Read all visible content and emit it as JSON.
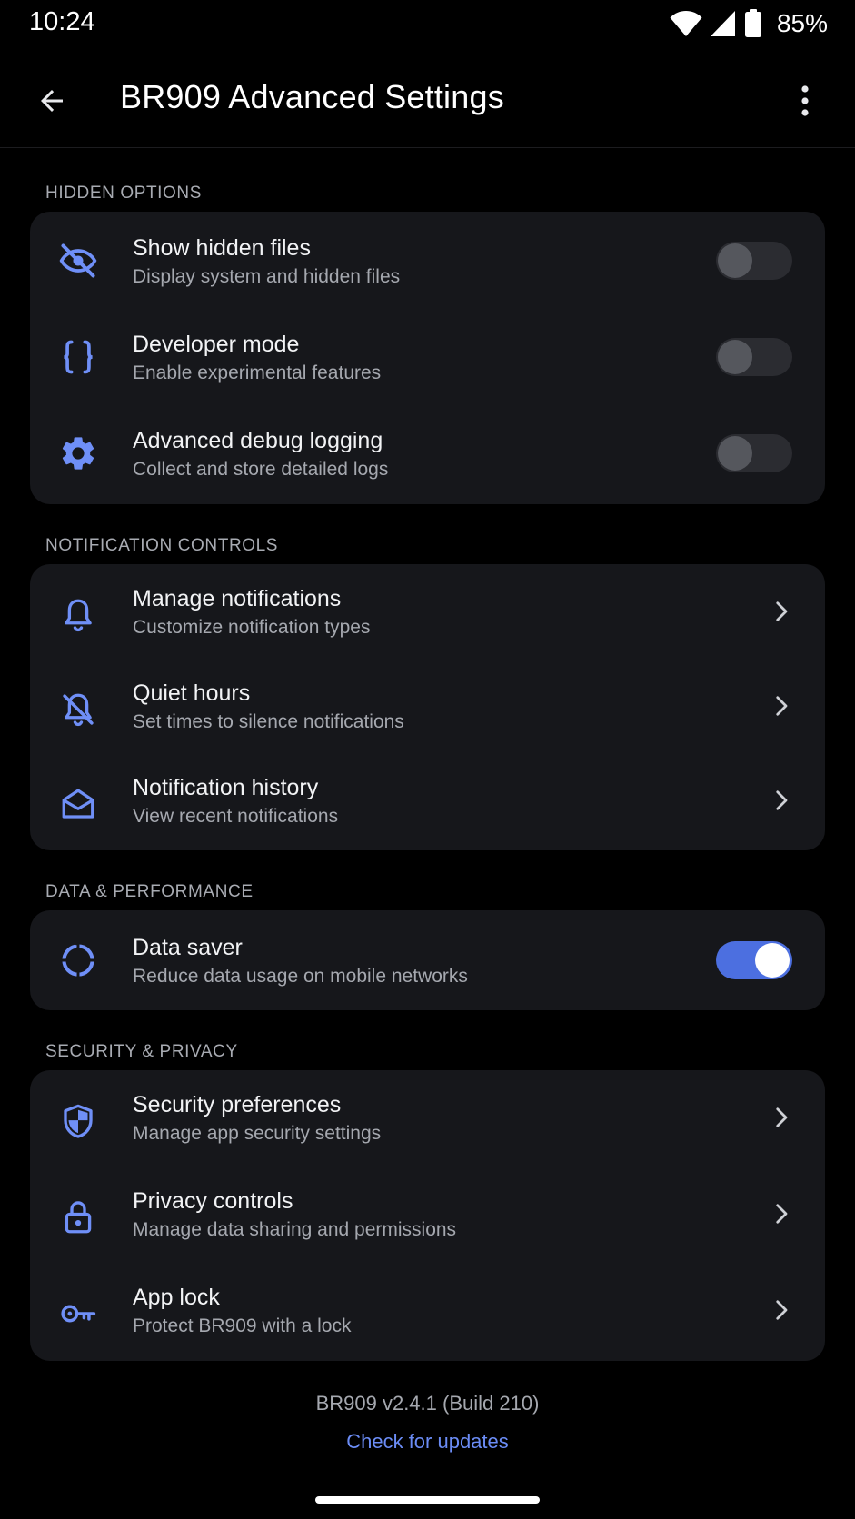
{
  "status_bar": {
    "time": "10:24",
    "battery": "85%",
    "icons": [
      "wifi-icon",
      "signal-icon",
      "battery-icon"
    ]
  },
  "app_bar": {
    "title": "BR909 Advanced Settings",
    "back_icon": "arrow-back-icon",
    "menu_icon": "more-vert-icon"
  },
  "colors": {
    "accent": "#4c6fe0",
    "link": "#6b8cf5",
    "card": "#16171b",
    "background": "#000000"
  },
  "sections": {
    "hidden": {
      "header": "HIDDEN OPTIONS",
      "items": [
        {
          "title": "Show hidden files",
          "subtitle": "Display system and hidden files",
          "icon": "eye-off-icon",
          "toggle": false
        },
        {
          "title": "Developer mode",
          "subtitle": "Enable experimental features",
          "icon": "code-braces-icon",
          "toggle": false
        },
        {
          "title": "Advanced debug logging",
          "subtitle": "Collect and store detailed logs",
          "icon": "gear-icon",
          "toggle": false
        }
      ]
    },
    "notifications": {
      "header": "NOTIFICATION CONTROLS",
      "items": [
        {
          "title": "Manage notifications",
          "subtitle": "Customize notification types",
          "icon": "bell-icon"
        },
        {
          "title": "Quiet hours",
          "subtitle": "Set times to silence notifications",
          "icon": "bell-off-icon"
        },
        {
          "title": "Notification history",
          "subtitle": "View recent notifications",
          "icon": "mail-open-icon"
        }
      ]
    },
    "data": {
      "header": "DATA & PERFORMANCE",
      "items": [
        {
          "title": "Data saver",
          "subtitle": "Reduce data usage on mobile networks",
          "icon": "data-saver-icon",
          "toggle": true
        }
      ]
    },
    "security": {
      "header": "SECURITY & PRIVACY",
      "items": [
        {
          "title": "Security preferences",
          "subtitle": "Manage app security settings",
          "icon": "shield-icon"
        },
        {
          "title": "Privacy controls",
          "subtitle": "Manage data sharing and permissions",
          "icon": "lock-icon"
        },
        {
          "title": "App lock",
          "subtitle": "Protect BR909 with a lock",
          "icon": "key-icon"
        }
      ]
    }
  },
  "footer": {
    "version": "BR909 v2.4.1 (Build 210)",
    "update_link": "Check for updates"
  }
}
